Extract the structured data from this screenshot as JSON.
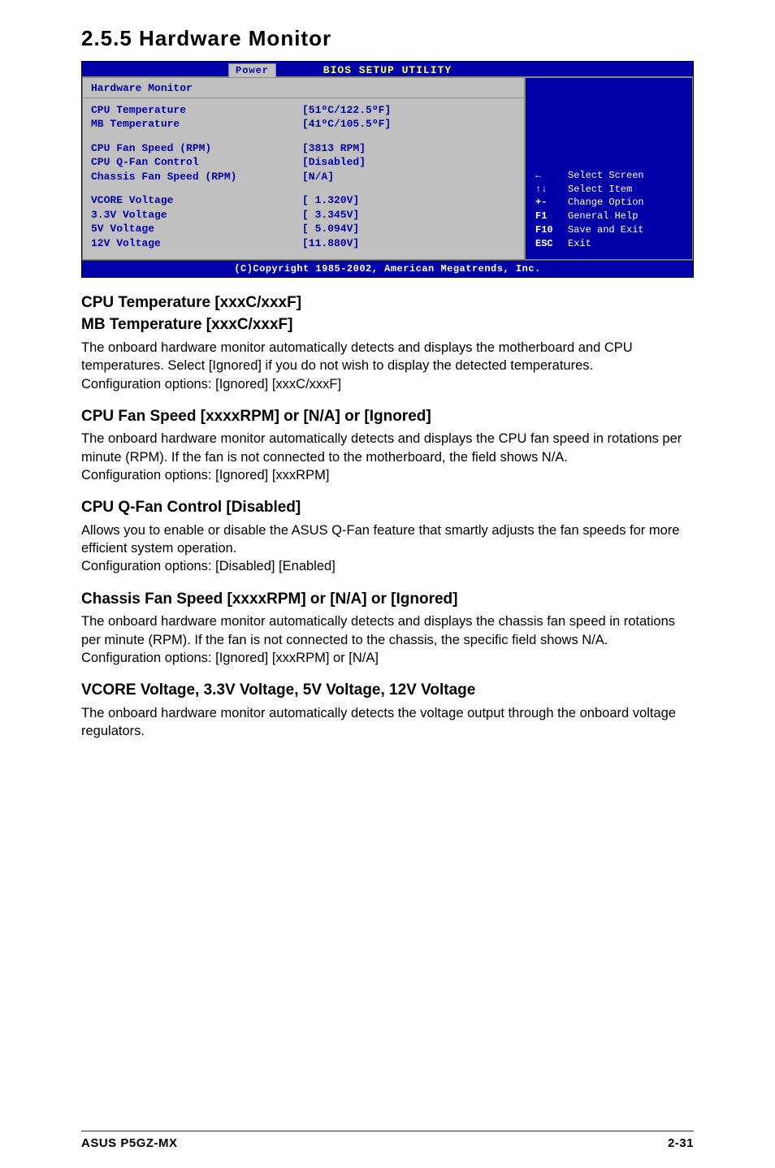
{
  "section_title": "2.5.5   Hardware Monitor",
  "bios": {
    "title": "BIOS SETUP UTILITY",
    "tab": "Power",
    "panel_title": "Hardware Monitor",
    "items": [
      {
        "label": "CPU Temperature",
        "value": "[51ºC/122.5ºF]"
      },
      {
        "label": "MB Temperature",
        "value": "[41ºC/105.5ºF]"
      },
      {
        "spacer": true
      },
      {
        "label": "CPU Fan Speed (RPM)",
        "value": "[3813 RPM]"
      },
      {
        "label": "CPU Q-Fan Control",
        "value": "[Disabled]"
      },
      {
        "label": "Chassis Fan Speed (RPM)",
        "value": "[N/A]"
      },
      {
        "spacer": true
      },
      {
        "label": "VCORE Voltage",
        "value": "[ 1.320V]"
      },
      {
        "label": "3.3V Voltage",
        "value": "[ 3.345V]"
      },
      {
        "label": "5V Voltage",
        "value": "[ 5.094V]"
      },
      {
        "label": "12V Voltage",
        "value": "[11.880V]"
      }
    ],
    "nav": [
      {
        "sym": "←",
        "text": "Select Screen"
      },
      {
        "sym": "↑↓",
        "text": "Select Item"
      },
      {
        "sym": "+-",
        "text": "Change Option"
      },
      {
        "sym": "F1",
        "text": "General Help"
      },
      {
        "sym": "F10",
        "text": "Save and Exit"
      },
      {
        "sym": "ESC",
        "text": "Exit"
      }
    ],
    "footer": "(C)Copyright 1985-2002, American Megatrends, Inc."
  },
  "paras": {
    "p1_h1": "CPU Temperature [xxxC/xxxF]",
    "p1_h2": "MB Temperature [xxxC/xxxF]",
    "p1_b": "The onboard hardware monitor automatically detects and displays the motherboard and CPU temperatures. Select [Ignored] if you do not wish to display the detected temperatures.\nConfiguration options: [Ignored] [xxxC/xxxF]",
    "p2_h": "CPU Fan Speed [xxxxRPM] or [N/A] or [Ignored]",
    "p2_b": "The onboard hardware monitor automatically detects and displays the CPU fan speed in rotations per minute (RPM). If the fan is not connected to the motherboard, the field shows N/A.\nConfiguration options: [Ignored] [xxxRPM]",
    "p3_h": "CPU Q-Fan Control [Disabled]",
    "p3_b": "Allows you to enable or disable the ASUS Q-Fan feature that smartly adjusts the fan speeds for more efficient system operation.\nConfiguration options: [Disabled] [Enabled]",
    "p4_h": "Chassis Fan Speed [xxxxRPM] or [N/A] or [Ignored]",
    "p4_b": "The onboard hardware monitor automatically detects and displays the chassis fan speed in rotations per minute (RPM). If the fan is not connected to the chassis, the specific field shows N/A.\nConfiguration options: [Ignored] [xxxRPM] or [N/A]",
    "p5_h": "VCORE Voltage, 3.3V Voltage, 5V Voltage, 12V Voltage",
    "p5_b": "The onboard hardware monitor automatically detects the voltage output through the onboard voltage regulators."
  },
  "footer": {
    "left": "ASUS P5GZ-MX",
    "right": "2-31"
  }
}
